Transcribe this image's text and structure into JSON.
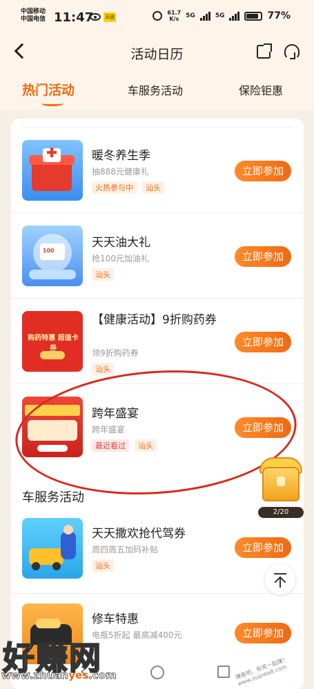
{
  "status_bar": {
    "carrier1": "中国移动",
    "carrier2": "中国电信",
    "time": "11:47",
    "badge": "天团",
    "speed_top": "61.7",
    "speed_bottom": "K/s",
    "net1": "5G",
    "net2": "5G",
    "battery": "77%"
  },
  "header": {
    "title": "活动日历",
    "icons": [
      "back-icon",
      "share-icon",
      "customer-service-icon"
    ]
  },
  "tabs": [
    {
      "label": "热门活动",
      "active": true
    },
    {
      "label": "车服务活动",
      "active": false
    },
    {
      "label": "保险钜惠",
      "active": false
    }
  ],
  "hot_activities": [
    {
      "title": "暖冬养生季",
      "subtitle": "抽888元健康礼",
      "tags": [
        "火热参与中",
        "汕头"
      ],
      "button": "立即参加"
    },
    {
      "title": "天天油大礼",
      "subtitle": "抢100元加油礼",
      "tags": [
        "汕头"
      ],
      "button": "立即参加"
    },
    {
      "title": "【健康活动】9折购药券",
      "subtitle": "领9折购药券",
      "tags": [
        "汕头"
      ],
      "button": "立即参加",
      "thumb_text": "购药特惠 超值卡券"
    },
    {
      "title": "跨年盛宴",
      "subtitle": "跨年盛宴",
      "tags": [
        "最近看过",
        "汕头"
      ],
      "button": "立即参加"
    }
  ],
  "car_section": {
    "title": "车服务活动",
    "items": [
      {
        "title": "天天撒欢抢代驾券",
        "subtitle": "周四周五加码补贴",
        "tags": [
          "汕头"
        ],
        "button": "立即参加"
      },
      {
        "title": "修车特惠",
        "subtitle": "电瓶5折起 最高减400元",
        "button": "立即参加"
      }
    ]
  },
  "floating": {
    "counter": "2/20"
  },
  "watermark": {
    "big": "好赚网",
    "url_pre": "www.zhuan",
    "url_hl": "yes",
    "url_post": ".com",
    "corner": "赚客吧，有奖一起赚！ www.zuanke8.com"
  },
  "colors": {
    "accent": "#ef6a13",
    "circle": "#d8281e"
  }
}
